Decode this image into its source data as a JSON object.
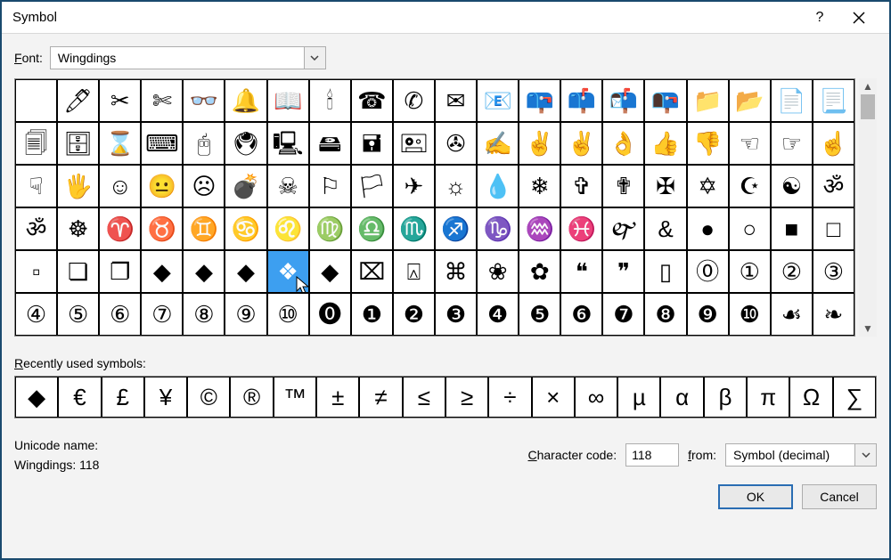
{
  "window": {
    "title": "Symbol",
    "help": "?",
    "close": "×"
  },
  "font": {
    "label": "Font:",
    "value": "Wingdings"
  },
  "grid": {
    "selected_index": 86,
    "cells": [
      " ",
      "🖊",
      "✂",
      "✄",
      "👓",
      "🔔",
      "📖",
      "🕯",
      "☎",
      "✆",
      "✉",
      "📧",
      "📪",
      "📫",
      "📬",
      "📭",
      "📁",
      "📂",
      "📄",
      "📃",
      "🗐",
      "🗄",
      "⌛",
      "⌨",
      "🖰",
      "🖲",
      "🖳",
      "🖴",
      "🖬",
      "🖭",
      "✇",
      "✍",
      "✌",
      "✌",
      "👌",
      "👍",
      "👎",
      "☜",
      "☞",
      "☝",
      "☟",
      "🖐",
      "☺",
      "😐",
      "☹",
      "💣",
      "☠",
      "⚐",
      "🏳",
      "✈",
      "☼",
      "💧",
      "❄",
      "✞",
      "✟",
      "✠",
      "✡",
      "☪",
      "☯",
      "ॐ",
      "ॐ",
      "☸",
      "♈",
      "♉",
      "♊",
      "♋",
      "♌",
      "♍",
      "♎",
      "♏",
      "♐",
      "♑",
      "♒",
      "♓",
      "🙰",
      "&",
      "●",
      "○",
      "■",
      "□",
      "▫",
      "❏",
      "❐",
      "◆",
      "◆",
      "◆",
      "❖",
      "◆",
      "⌧",
      "⍓",
      "⌘",
      "❀",
      "✿",
      "❝",
      "❞",
      "▯",
      "⓪",
      "①",
      "②",
      "③",
      "④",
      "⑤",
      "⑥",
      "⑦",
      "⑧",
      "⑨",
      "⑩",
      "⓿",
      "❶",
      "❷",
      "❸",
      "❹",
      "❺",
      "❻",
      "❼",
      "❽",
      "❾",
      "❿",
      "☙",
      "❧"
    ]
  },
  "recent": {
    "label": "Recently used symbols:",
    "cells": [
      "◆",
      "€",
      "£",
      "¥",
      "©",
      "®",
      "™",
      "±",
      "≠",
      "≤",
      "≥",
      "÷",
      "×",
      "∞",
      "µ",
      "α",
      "β",
      "π",
      "Ω",
      "∑"
    ]
  },
  "unicode": {
    "label": "Unicode name:",
    "value": "Wingdings: 118"
  },
  "char_code": {
    "label": "Character code:",
    "value": "118"
  },
  "from": {
    "label": "from:",
    "value": "Symbol (decimal)"
  },
  "buttons": {
    "ok": "OK",
    "cancel": "Cancel"
  }
}
